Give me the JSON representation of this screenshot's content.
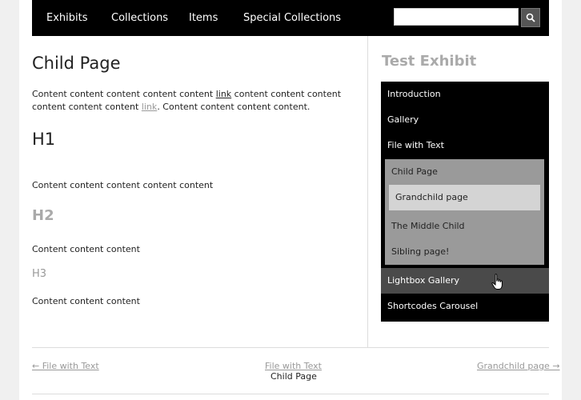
{
  "topnav": {
    "items": [
      "Exhibits",
      "Collections",
      "Items",
      "Special Collections"
    ],
    "search_value": "",
    "search_icon": "search-icon"
  },
  "main": {
    "title": "Child Page",
    "para_part1": "Content content content content content ",
    "para_link1": "link",
    "para_part2": " content content content content content content ",
    "para_link2": "link",
    "para_part3": ". Content content content content.",
    "h1": "H1",
    "text1": "Content content content content content",
    "h2": "H2",
    "text2": "Content content content",
    "h3": "H3",
    "text3": "Content content content"
  },
  "sidebar": {
    "exhibit_title": "Test Exhibit",
    "items": [
      "Introduction",
      "Gallery",
      "File with Text"
    ],
    "subitems": [
      "Child Page",
      "Grandchild page",
      "The Middle Child",
      "Sibling page!"
    ],
    "items_after": [
      "Lightbox Gallery",
      "Shortcodes Carousel"
    ]
  },
  "footer": {
    "prev_link": "← File with Text",
    "up_link": "File with Text",
    "current": "Child Page",
    "next_link": "Grandchild page →"
  },
  "colors": {
    "nav_bg": "#000000",
    "subnav_bg": "#9a9a9a",
    "active_bg": "#d4d4d4",
    "hover_bg": "#4a4a4a",
    "muted_text": "#aaaaaa"
  }
}
